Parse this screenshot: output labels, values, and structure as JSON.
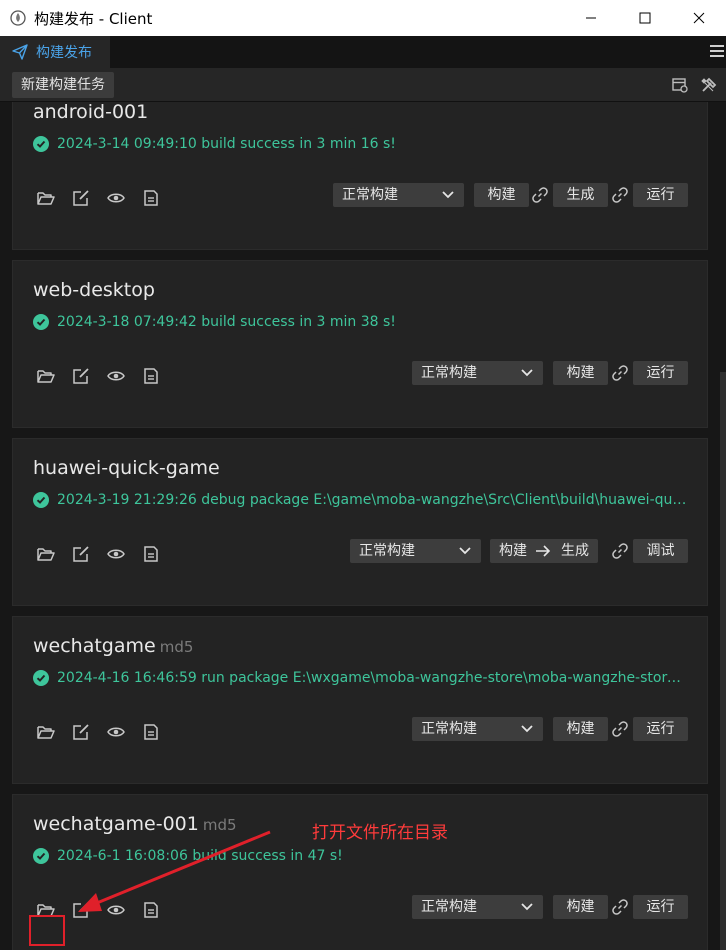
{
  "window": {
    "title": "构建发布 - Client"
  },
  "tab": {
    "label": "构建发布"
  },
  "toolbar": {
    "new_task_label": "新建构建任务"
  },
  "tasks": [
    {
      "name": "android-001",
      "badge": "",
      "message": "2024-3-14 09:49:10 build success in 3 min 16 s!",
      "mode": "正常构建",
      "build": "构建",
      "make": "生成",
      "run": "运行"
    },
    {
      "name": "web-desktop",
      "badge": "",
      "message": "2024-3-18 07:49:42 build success in 3 min 38 s!",
      "mode": "正常构建",
      "build": "构建",
      "run": "运行"
    },
    {
      "name": "huawei-quick-game",
      "badge": "",
      "message": "2024-3-19 21:29:26 debug package E:\\game\\moba-wangzhe\\Src\\Client\\build\\huawei-quick-game...",
      "mode": "正常构建",
      "build": "构建",
      "make": "生成",
      "debug": "调试"
    },
    {
      "name": "wechatgame",
      "badge": "md5",
      "message": "2024-4-16 16:46:59 run package E:\\wxgame\\moba-wangzhe-store\\moba-wangzhe-store\\buil...",
      "mode": "正常构建",
      "build": "构建",
      "run": "运行"
    },
    {
      "name": "wechatgame-001",
      "badge": "md5",
      "message": "2024-6-1 16:08:06 build success in 47 s!",
      "mode": "正常构建",
      "build": "构建",
      "run": "运行"
    }
  ],
  "annotation": {
    "text": "打开文件所在目录"
  },
  "colors": {
    "success": "#3ec59b",
    "accent": "#4aa3e8",
    "annotation": "#ff3b3b"
  }
}
